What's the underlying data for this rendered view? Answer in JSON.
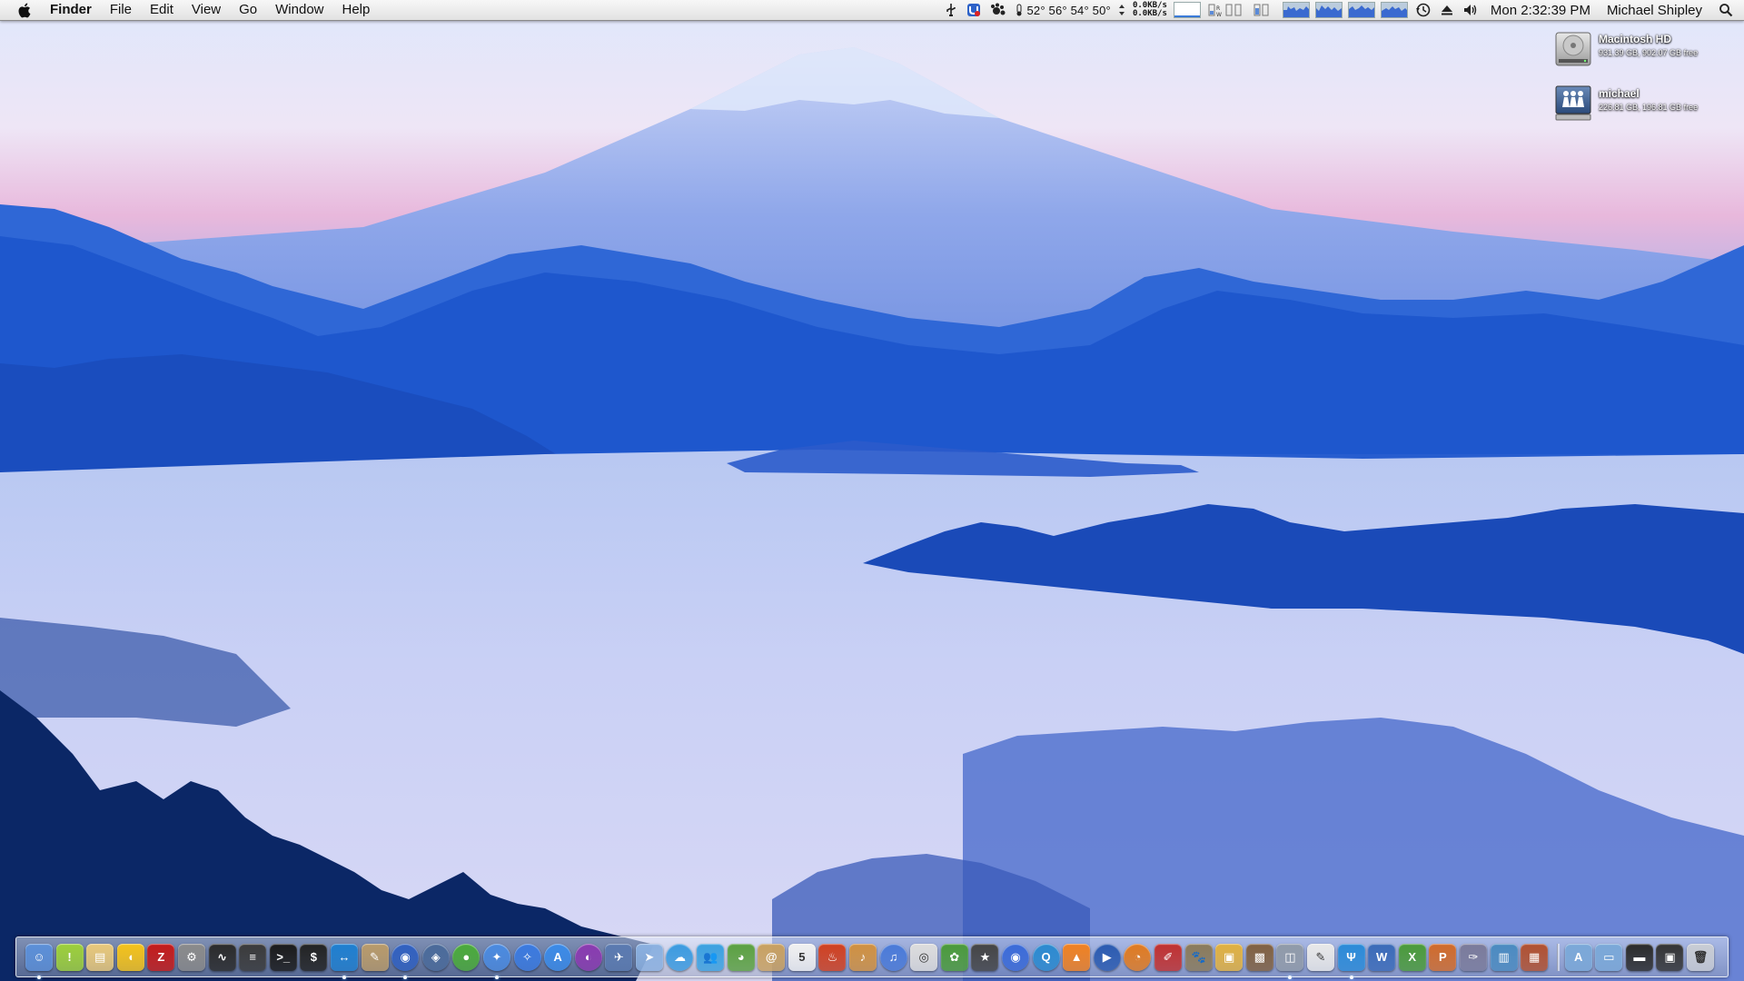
{
  "menubar": {
    "app_name": "Finder",
    "menus": [
      "File",
      "Edit",
      "View",
      "Go",
      "Window",
      "Help"
    ],
    "temperatures": "52° 56° 54° 50°",
    "net_up": "0.0KB/s",
    "net_down": "0.0KB/s",
    "clock": "Mon 2:32:39 PM",
    "user": "Michael Shipley",
    "icons": [
      "apple-icon",
      "usb-icon",
      "ublock-icon",
      "gear-paw-icon",
      "temperature-arrows-icon",
      "network-graph-icon",
      "disk-activity-icon",
      "cpu-graph-icon",
      "time-machine-icon",
      "eject-icon",
      "volume-icon",
      "spotlight-icon"
    ]
  },
  "desktop": {
    "icons": [
      {
        "name": "Macintosh HD",
        "info": "931.39 GB, 902.07 GB free",
        "icon": "hard-drive-icon"
      },
      {
        "name": "michael",
        "info": "226.81 GB, 196.81 GB free",
        "icon": "network-share-icon"
      }
    ]
  },
  "dock": {
    "items": [
      {
        "name": "finder",
        "color": "#5b8fd8",
        "glyph": "☺",
        "running": true
      },
      {
        "name": "stickies",
        "color": "#9ccf3a",
        "glyph": "!",
        "running": false
      },
      {
        "name": "preview",
        "color": "#e8c87a",
        "glyph": "▤",
        "running": false
      },
      {
        "name": "cyberduck",
        "color": "#f4c21a",
        "glyph": "◖",
        "running": false
      },
      {
        "name": "filezilla",
        "color": "#c41a1a",
        "glyph": "Z",
        "running": false
      },
      {
        "name": "system-preferences",
        "color": "#8a8a8a",
        "glyph": "⚙",
        "running": false
      },
      {
        "name": "activity-monitor",
        "color": "#2a2a2a",
        "glyph": "∿",
        "running": false
      },
      {
        "name": "console",
        "color": "#3a3a3a",
        "glyph": "≡",
        "running": false
      },
      {
        "name": "terminal",
        "color": "#1a1a1a",
        "glyph": ">_",
        "running": false
      },
      {
        "name": "secure-shell",
        "color": "#222222",
        "glyph": "$",
        "running": false
      },
      {
        "name": "teamviewer",
        "color": "#1e7fd0",
        "glyph": "↔",
        "running": true
      },
      {
        "name": "script-editor",
        "color": "#b89a6a",
        "glyph": "✎",
        "running": false
      },
      {
        "name": "network-utility",
        "color": "#3060c0",
        "glyph": "◉",
        "running": true
      },
      {
        "name": "dashboard",
        "color": "#4a6a9a",
        "glyph": "◈",
        "running": false
      },
      {
        "name": "camino",
        "color": "#4aaa3a",
        "glyph": "●",
        "running": false
      },
      {
        "name": "safari",
        "color": "#4a8ae0",
        "glyph": "✦",
        "running": true
      },
      {
        "name": "safari-webkit",
        "color": "#3a7ae0",
        "glyph": "✧",
        "running": false
      },
      {
        "name": "app-store",
        "color": "#3a8ae8",
        "glyph": "A",
        "running": false
      },
      {
        "name": "torrent",
        "color": "#8a3ab0",
        "glyph": "◐",
        "running": false
      },
      {
        "name": "xcode",
        "color": "#5a7ab0",
        "glyph": "✈",
        "running": false
      },
      {
        "name": "mail",
        "color": "#8ab0e0",
        "glyph": "➤",
        "running": false
      },
      {
        "name": "ichat",
        "color": "#3a9ae0",
        "glyph": "☁",
        "running": false
      },
      {
        "name": "messenger",
        "color": "#3aa0e0",
        "glyph": "👥",
        "running": false
      },
      {
        "name": "adium",
        "color": "#5aa040",
        "glyph": "◕",
        "running": false
      },
      {
        "name": "address-book",
        "color": "#c8a060",
        "glyph": "@",
        "running": false
      },
      {
        "name": "ical",
        "color": "#f0f0f0",
        "glyph": "5",
        "running": false
      },
      {
        "name": "logic",
        "color": "#d04020",
        "glyph": "♨",
        "running": false
      },
      {
        "name": "garageband",
        "color": "#d09040",
        "glyph": "♪",
        "running": false
      },
      {
        "name": "itunes",
        "color": "#4a7ad8",
        "glyph": "♫",
        "running": false
      },
      {
        "name": "ipod",
        "color": "#dcdcdc",
        "glyph": "◎",
        "running": false
      },
      {
        "name": "fruit-menu",
        "color": "#4a9a3a",
        "glyph": "✿",
        "running": false
      },
      {
        "name": "imovie",
        "color": "#444444",
        "glyph": "★",
        "running": false
      },
      {
        "name": "dvd-player",
        "color": "#3a6ad8",
        "glyph": "◉",
        "running": false
      },
      {
        "name": "quicktime",
        "color": "#2a8ad0",
        "glyph": "Q",
        "running": false
      },
      {
        "name": "vlc",
        "color": "#f08020",
        "glyph": "▲",
        "running": false
      },
      {
        "name": "quicktime-player",
        "color": "#2a5ab0",
        "glyph": "▶",
        "running": false
      },
      {
        "name": "blender",
        "color": "#e07a20",
        "glyph": "◔",
        "running": false
      },
      {
        "name": "scrivener",
        "color": "#c03030",
        "glyph": "✐",
        "running": false
      },
      {
        "name": "gimp",
        "color": "#8a7a5a",
        "glyph": "🐾",
        "running": false
      },
      {
        "name": "image-capture",
        "color": "#e0b040",
        "glyph": "▣",
        "running": false
      },
      {
        "name": "iphoto",
        "color": "#806040",
        "glyph": "▩",
        "running": false
      },
      {
        "name": "photo-booth",
        "color": "#909aa8",
        "glyph": "◫",
        "running": true
      },
      {
        "name": "textedit",
        "color": "#e8e8e8",
        "glyph": "✎",
        "running": false
      },
      {
        "name": "neptune",
        "color": "#2a8ad8",
        "glyph": "Ψ",
        "running": true
      },
      {
        "name": "word",
        "color": "#3a6ab8",
        "glyph": "W",
        "running": false
      },
      {
        "name": "excel",
        "color": "#4a9a3a",
        "glyph": "X",
        "running": false
      },
      {
        "name": "powerpoint",
        "color": "#d06a2a",
        "glyph": "P",
        "running": false
      },
      {
        "name": "pencil",
        "color": "#7a7a9a",
        "glyph": "✑",
        "running": false
      },
      {
        "name": "numbers",
        "color": "#4a8ac0",
        "glyph": "▥",
        "running": false
      },
      {
        "name": "presentation",
        "color": "#b05030",
        "glyph": "▦",
        "running": false
      },
      {
        "name": "applications-stack",
        "color": "#7aa8d8",
        "glyph": "A",
        "running": false,
        "sep_before": true
      },
      {
        "name": "documents-stack",
        "color": "#7aa8d8",
        "glyph": "▭",
        "running": false
      },
      {
        "name": "screen-stack",
        "color": "#2a2a2a",
        "glyph": "▬",
        "running": false
      },
      {
        "name": "monitor-stack",
        "color": "#333333",
        "glyph": "▣",
        "running": false
      },
      {
        "name": "trash",
        "color": "#c8ccd4",
        "glyph": "🗑",
        "running": false
      }
    ]
  }
}
